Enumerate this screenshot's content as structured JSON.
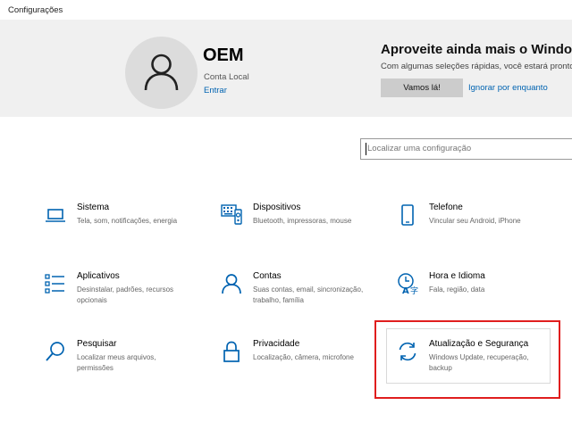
{
  "window": {
    "title": "Configurações"
  },
  "account": {
    "name": "OEM",
    "type": "Conta Local",
    "link": "Entrar"
  },
  "promo": {
    "title": "Aproveite ainda mais o Windows",
    "text": "Com algumas seleções rápidas, você estará pronto",
    "button": "Vamos lá!",
    "link": "Ignorar por enquanto"
  },
  "search": {
    "placeholder": "Localizar uma configuração"
  },
  "accent": "#0063b1",
  "highlight_color": "#e01e1e",
  "categories": [
    {
      "icon": "laptop-icon",
      "title": "Sistema",
      "desc": "Tela, som, notificações, energia"
    },
    {
      "icon": "keyboard-icon",
      "title": "Dispositivos",
      "desc": "Bluetooth, impressoras, mouse"
    },
    {
      "icon": "phone-icon",
      "title": "Telefone",
      "desc": "Vincular seu Android, iPhone"
    },
    {
      "icon": "apps-list-icon",
      "title": "Aplicativos",
      "desc": "Desinstalar, padrões, recursos opcionais"
    },
    {
      "icon": "person-icon",
      "title": "Contas",
      "desc": "Suas contas, email, sincronização, trabalho, família"
    },
    {
      "icon": "time-language-icon",
      "title": "Hora e Idioma",
      "desc": "Fala, região, data"
    },
    {
      "icon": "search-icon",
      "title": "Pesquisar",
      "desc": "Localizar meus arquivos, permissões"
    },
    {
      "icon": "lock-icon",
      "title": "Privacidade",
      "desc": "Localização, câmera, microfone"
    },
    {
      "icon": "sync-icon",
      "title": "Atualização e Segurança",
      "desc": "Windows Update, recuperação, backup"
    }
  ]
}
